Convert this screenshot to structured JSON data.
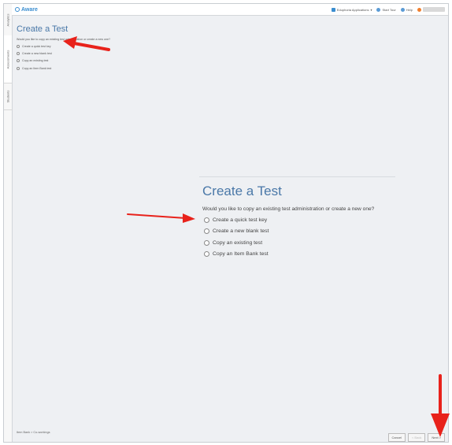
{
  "side_tabs": [
    "Analytics",
    "Assessments",
    "Students"
  ],
  "app": {
    "name": "Aware"
  },
  "topbar": {
    "apps_label": "Eduphoria Applications",
    "tour_label": "Start Tour",
    "help_label": "Help"
  },
  "page": {
    "title": "Create a Test",
    "question": "Would you like to copy an existing test administration or create a new one?",
    "options": [
      "Create a quick test key",
      "Create a new blank test",
      "Copy an existing test",
      "Copy an Item Bank test"
    ]
  },
  "footer": {
    "text": "Item Bank  >  Co-workings"
  },
  "buttons": {
    "cancel": "Cancel",
    "back": "< Back",
    "next": "Next >"
  },
  "colors": {
    "accent": "#4a78a8",
    "arrow": "#e8221b"
  }
}
